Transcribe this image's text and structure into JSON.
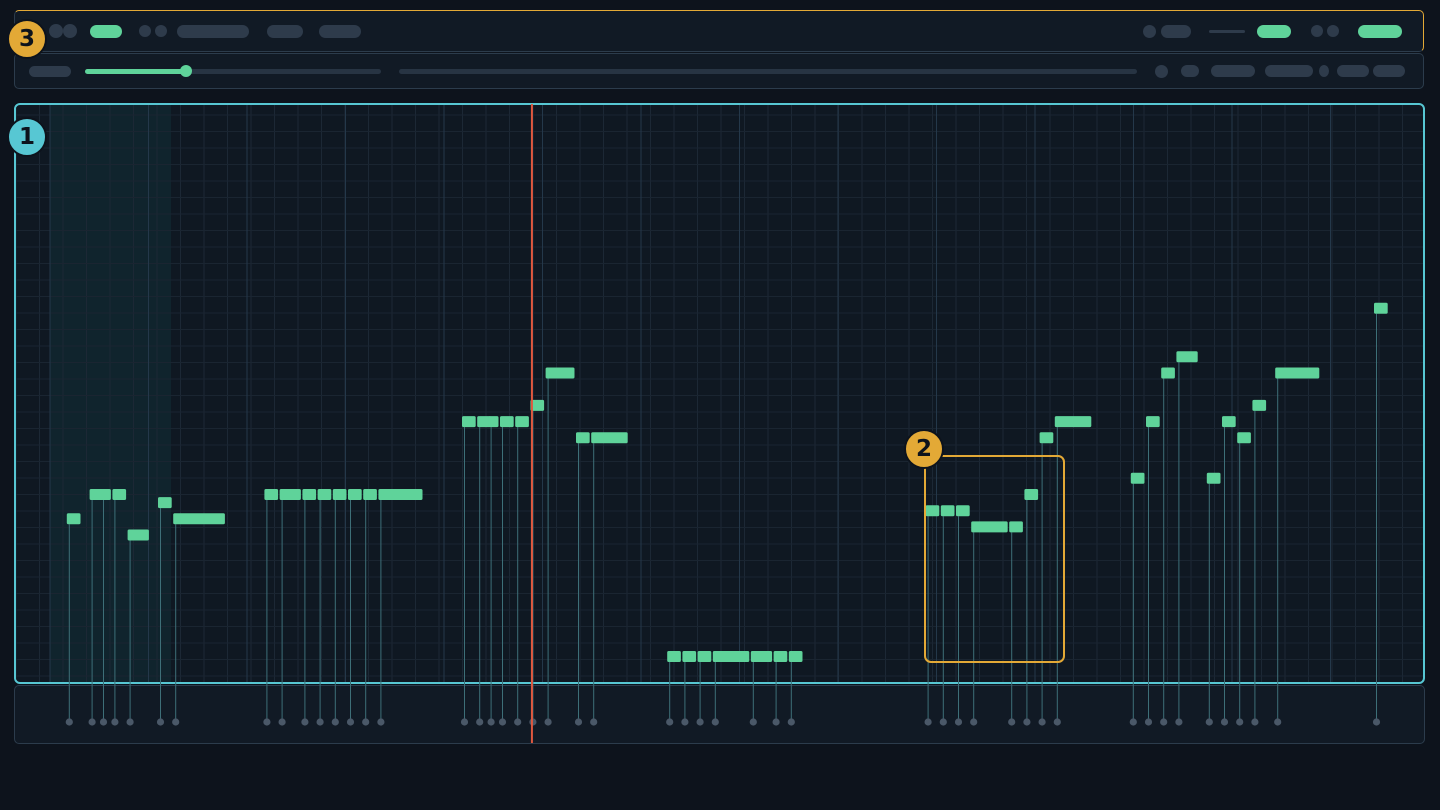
{
  "callouts": {
    "grid": "1",
    "selection": "2",
    "toolbar": "3"
  },
  "colors": {
    "background": "#0d131c",
    "note": "#5fd39a",
    "grid_outline": "#57c7d3",
    "selection": "#e3a936",
    "playhead": "#e0583f"
  },
  "editor": {
    "playback_progress": 0.34,
    "notes": [
      {
        "t": 3,
        "d": 2,
        "p": 34
      },
      {
        "t": 6,
        "d": 2,
        "p": 37
      },
      {
        "t": 7.5,
        "d": 1.5,
        "p": 37
      },
      {
        "t": 9,
        "d": 2,
        "p": 37
      },
      {
        "t": 11,
        "d": 3,
        "p": 32
      },
      {
        "t": 15,
        "d": 2,
        "p": 36
      },
      {
        "t": 17,
        "d": 7,
        "p": 34
      },
      {
        "t": 29,
        "d": 2,
        "p": 37
      },
      {
        "t": 31,
        "d": 3,
        "p": 37
      },
      {
        "t": 34,
        "d": 2,
        "p": 37
      },
      {
        "t": 36,
        "d": 2,
        "p": 37
      },
      {
        "t": 38,
        "d": 2,
        "p": 37
      },
      {
        "t": 40,
        "d": 2,
        "p": 37
      },
      {
        "t": 42,
        "d": 2,
        "p": 37
      },
      {
        "t": 44,
        "d": 6,
        "p": 37
      },
      {
        "t": 55,
        "d": 2,
        "p": 46
      },
      {
        "t": 57,
        "d": 2,
        "p": 46
      },
      {
        "t": 58.5,
        "d": 1.5,
        "p": 46
      },
      {
        "t": 60,
        "d": 2,
        "p": 46
      },
      {
        "t": 62,
        "d": 2,
        "p": 46
      },
      {
        "t": 64,
        "d": 2,
        "p": 48
      },
      {
        "t": 66,
        "d": 4,
        "p": 52
      },
      {
        "t": 70,
        "d": 2,
        "p": 44
      },
      {
        "t": 72,
        "d": 5,
        "p": 44
      },
      {
        "t": 82,
        "d": 2,
        "p": 17
      },
      {
        "t": 84,
        "d": 2,
        "p": 17
      },
      {
        "t": 86,
        "d": 2,
        "p": 17
      },
      {
        "t": 88,
        "d": 5,
        "p": 17
      },
      {
        "t": 93,
        "d": 3,
        "p": 17
      },
      {
        "t": 96,
        "d": 2,
        "p": 17
      },
      {
        "t": 98,
        "d": 2,
        "p": 17
      },
      {
        "t": 116,
        "d": 2,
        "p": 35
      },
      {
        "t": 118,
        "d": 2,
        "p": 35
      },
      {
        "t": 120,
        "d": 2,
        "p": 35
      },
      {
        "t": 122,
        "d": 5,
        "p": 33
      },
      {
        "t": 127,
        "d": 2,
        "p": 33
      },
      {
        "t": 129,
        "d": 2,
        "p": 37
      },
      {
        "t": 131,
        "d": 2,
        "p": 44
      },
      {
        "t": 133,
        "d": 5,
        "p": 46
      },
      {
        "t": 143,
        "d": 2,
        "p": 39
      },
      {
        "t": 145,
        "d": 2,
        "p": 46
      },
      {
        "t": 147,
        "d": 2,
        "p": 52
      },
      {
        "t": 149,
        "d": 3,
        "p": 54
      },
      {
        "t": 153,
        "d": 2,
        "p": 39
      },
      {
        "t": 155,
        "d": 2,
        "p": 46
      },
      {
        "t": 157,
        "d": 2,
        "p": 44
      },
      {
        "t": 159,
        "d": 2,
        "p": 48
      },
      {
        "t": 162,
        "d": 6,
        "p": 52
      },
      {
        "t": 175,
        "d": 2,
        "p": 60
      }
    ]
  }
}
